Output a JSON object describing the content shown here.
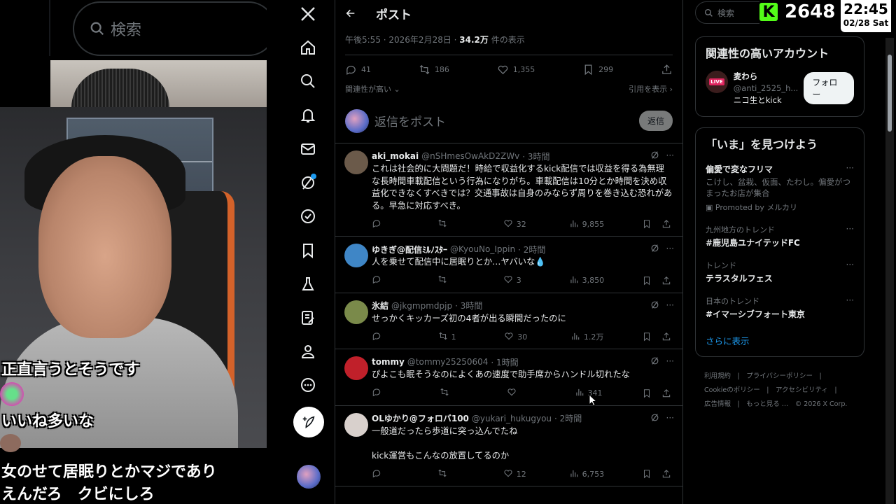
{
  "stream": {
    "bg_search_placeholder": "検索",
    "chat": [
      {
        "text": "正直言うとそうです"
      },
      {
        "text": "いいね多いな"
      },
      {
        "text": "女のせて居眠りとかマジであり"
      },
      {
        "text": "えんだろ　クビにしろ"
      }
    ]
  },
  "nav": {
    "items": [
      "x-logo-icon",
      "home-icon",
      "search-icon",
      "notifications-icon",
      "messages-icon",
      "grok-icon",
      "premium-icon",
      "bookmarks-icon",
      "labs-icon",
      "articles-icon",
      "profile-icon",
      "more-icon"
    ]
  },
  "post": {
    "header_title": "ポスト",
    "meta_prefix": "午後5:55 · 2026年2月28日 · ",
    "views": "34.2万",
    "views_suffix": " 件の表示",
    "stats": {
      "replies": "41",
      "reposts": "186",
      "likes": "1,355",
      "bookmarks": "299"
    },
    "relevance_label": "関連性が高い",
    "quotes_label": "引用を表示",
    "reply_placeholder": "返信をポスト",
    "reply_button": "返信"
  },
  "replies": [
    {
      "name": "aki_mokai",
      "handle": "@nSHmesOwAkD2ZWv",
      "time": "· 3時間",
      "body": "これは社会的に大問題だ！時給で収益化するkick配信では収益を得る為無理な長時間車載配信という行為になりがち。車載配信は10分とか時間を決め収益化できなくすべきでは？交通事故は自身のみならず周りを巻き込む恐れがある。早急に対応すべき。",
      "reply": "",
      "repost": "",
      "like": "32",
      "views": "9,855",
      "avatar_color": "#6b5a4a"
    },
    {
      "name": "ゆきぎ@配信ﾐﾙﾉｽﾀｰ",
      "handle": "@KyouNo_Ippin",
      "time": "· 2時間",
      "body": "人を乗せて配信中に居眠りとか…ヤバいな💧",
      "reply": "",
      "repost": "",
      "like": "3",
      "views": "3,850",
      "avatar_color": "#3f86c6"
    },
    {
      "name": "氷結",
      "handle": "@jkgmpmdpjp",
      "time": "· 3時間",
      "body": "せっかくキッカーズ初の4者が出る瞬間だったのに",
      "reply": "",
      "repost": "1",
      "like": "30",
      "views": "1.2万",
      "avatar_color": "#7a8a4a"
    },
    {
      "name": "tommy",
      "handle": "@tommy25250604",
      "time": "· 1時間",
      "body": "ぴよこも眠そうなのによくあの速度で助手席からハンドル切れたな",
      "reply": "",
      "repost": "",
      "like": "",
      "views": "341",
      "avatar_color": "#c0202a"
    },
    {
      "name": "OLゆかり@フォロバ100",
      "handle": "@yukari_hukugyou",
      "time": "· 2時間",
      "body": "一般道だったら歩道に突っ込んでたね\n\nkick運営もこんなの放置してるのか",
      "reply": "",
      "repost": "",
      "like": "12",
      "views": "6,753",
      "avatar_color": "#d8d0cc"
    }
  ],
  "right": {
    "search_placeholder": "検索",
    "kick_count": "2648",
    "clock_time": "22:45",
    "clock_date": "02/28 Sat",
    "related_title": "関連性の高いアカウント",
    "account": {
      "name": "麦わら",
      "handle": "@anti_2525_h...",
      "bio": "ニコ生とkick",
      "live": "LIVE",
      "follow": "フォロー"
    },
    "explore_title": "「いま」を見つけよう",
    "trends": [
      {
        "cat": "",
        "name": "偏愛で変なフリマ",
        "desc": "こけし、盆栽、仮面、たわし。偏愛がつまったお店が集合",
        "promo": "Promoted by メルカリ"
      },
      {
        "cat": "九州地方のトレンド",
        "name": "#鹿児島ユナイテッドFC",
        "desc": "",
        "promo": ""
      },
      {
        "cat": "トレンド",
        "name": "テラスタルフェス",
        "desc": "",
        "promo": ""
      },
      {
        "cat": "日本のトレンド",
        "name": "#イマーシブフォート東京",
        "desc": "",
        "promo": ""
      }
    ],
    "show_more": "さらに表示",
    "footer": [
      "利用規約",
      "プライバシーポリシー",
      "Cookieのポリシー",
      "アクセシビリティ",
      "広告情報",
      "もっと見る …",
      "© 2026 X Corp."
    ]
  },
  "colors": {
    "accent": "#1d9bf0",
    "kick_green": "#53fc18",
    "bg": "#000000",
    "muted": "#71767b"
  }
}
